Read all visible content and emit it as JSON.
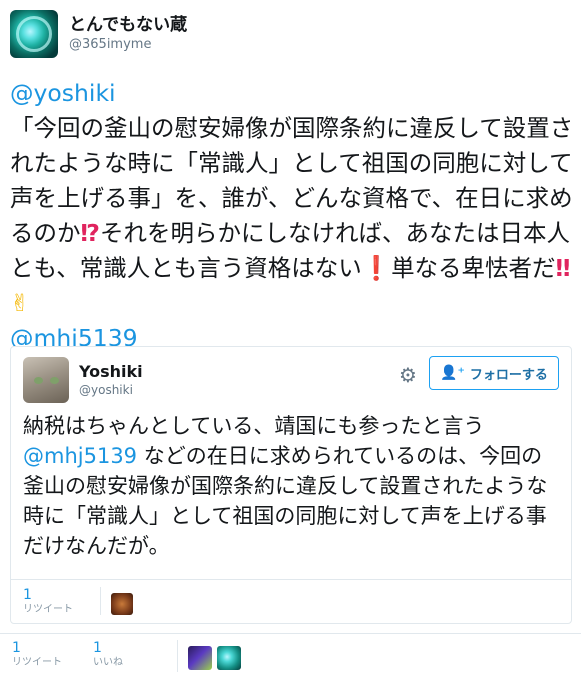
{
  "author": {
    "display_name": "とんでもない蔵",
    "handle": "@365imyme",
    "avatar_icon": "teal-ring-avatar-icon"
  },
  "tweet": {
    "reply_mention": "@yoshiki",
    "body": "「今回の釜山の慰安婦像が国際条約に違反して設置されたような時に「常識人」として祖国の同胞に対して声を上げる事」を、誰が、どんな資格で、在日に求めるのか",
    "interrobang": "⁉",
    "body2": "それを明らかにしなければ、あなたは日本人とも、常識人とも言う資格はない",
    "exclamation": "❗",
    "body3": "単なる卑怯者だ",
    "double_exclamation": "‼",
    "victory": "✌",
    "trailing_mention": "@mhj5139"
  },
  "quoted": {
    "display_name": "Yoshiki",
    "handle": "@yoshiki",
    "avatar_icon": "cat-avatar-icon",
    "settings_icon": "gear-icon",
    "follow_icon": "person-add-icon",
    "follow_label": "フォローする",
    "text_before": "納税はちゃんとしている、靖国にも参ったと言う ",
    "text_mention": "@mhj5139",
    "text_after": " などの在日に求められているのは、今回の釜山の慰安婦像が国際条約に違反して設置されたような時に「常識人」として祖国の同胞に対して声を上げる事だけなんだが。",
    "retweets_count": "1",
    "retweets_label": "リツイート"
  },
  "stats": {
    "retweets_count": "1",
    "retweets_label": "リツイート",
    "likes_count": "1",
    "likes_label": "いいね"
  },
  "colors": {
    "link": "#1b95e0",
    "text": "#14171a",
    "muted": "#657786",
    "border": "#e1e8ed",
    "follow_border": "#1da1f2"
  }
}
